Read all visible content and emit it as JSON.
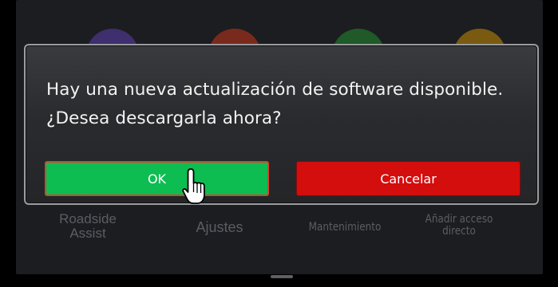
{
  "dialog": {
    "message_line1": "Hay una nueva actualización de software disponible.",
    "message_line2": "¿Desea descargarla ahora?",
    "ok_label": "OK",
    "cancel_label": "Cancelar"
  },
  "home": {
    "labels": {
      "roadside_line1": "Roadside",
      "roadside_line2": "Assist",
      "ajustes": "Ajustes",
      "mantenimiento": "Mantenimiento",
      "anadir_line1": "Añadir acceso",
      "anadir_line2": "directo"
    }
  },
  "colors": {
    "ok_button": "#0dbd52",
    "ok_border": "#d6452d",
    "cancel_button": "#d40d0d",
    "dialog_background": "#2e2f32",
    "screen_background": "#1c1d20"
  },
  "cursor": {
    "icon": "hand-pointer-icon"
  }
}
